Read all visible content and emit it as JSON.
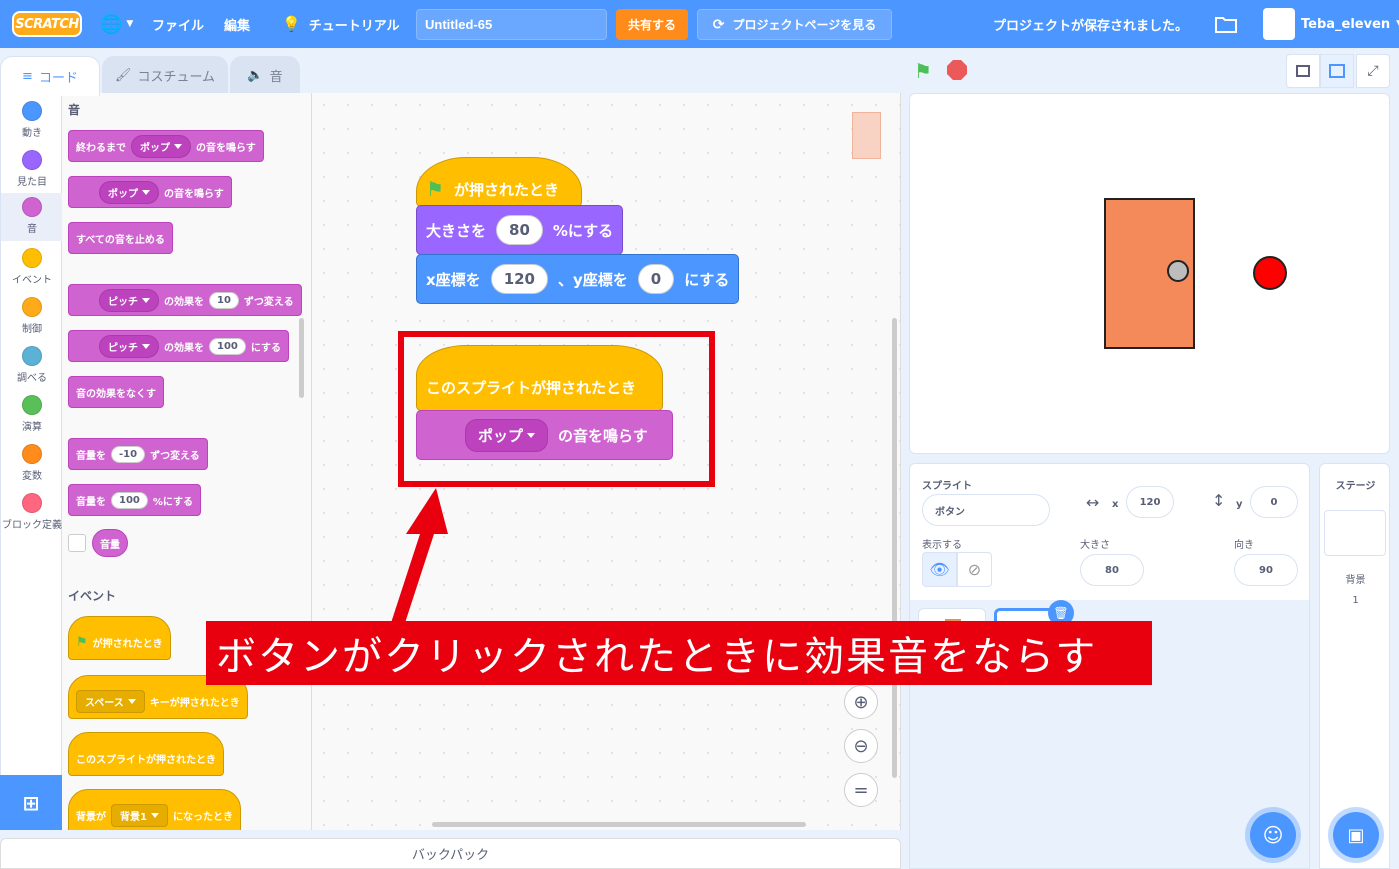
{
  "menubar": {
    "logo": "SCRATCH",
    "file": "ファイル",
    "edit": "編集",
    "tutorial": "チュートリアル",
    "project_title": "Untitled-65",
    "share": "共有する",
    "project_page": "プロジェクトページを見る",
    "save_status": "プロジェクトが保存されました。",
    "username": "Teba_eleven"
  },
  "tabs": {
    "code": "コード",
    "costume": "コスチューム",
    "sound": "音"
  },
  "categories": [
    {
      "label": "動き",
      "color": "#4c97ff"
    },
    {
      "label": "見た目",
      "color": "#9966ff"
    },
    {
      "label": "音",
      "color": "#cf63cf"
    },
    {
      "label": "イベント",
      "color": "#ffbf00"
    },
    {
      "label": "制御",
      "color": "#ffab19"
    },
    {
      "label": "調べる",
      "color": "#5cb1d6"
    },
    {
      "label": "演算",
      "color": "#59c059"
    },
    {
      "label": "変数",
      "color": "#ff8c1a"
    },
    {
      "label": "ブロック定義",
      "color": "#ff6680"
    }
  ],
  "palette": {
    "sound_header": "音",
    "play_until_done_a": "終わるまで",
    "play_until_done_dd": "ポップ",
    "play_until_done_b": "の音を鳴らす",
    "start_sound_dd": "ポップ",
    "start_sound_b": "の音を鳴らす",
    "stop_all": "すべての音を止める",
    "change_effect_dd": "ピッチ",
    "change_effect_a": "の効果を",
    "change_effect_val": "10",
    "change_effect_b": "ずつ変える",
    "set_effect_dd": "ピッチ",
    "set_effect_a": "の効果を",
    "set_effect_val": "100",
    "set_effect_b": "にする",
    "clear_effects": "音の効果をなくす",
    "change_vol_a": "音量を",
    "change_vol_val": "-10",
    "change_vol_b": "ずつ変える",
    "set_vol_a": "音量を",
    "set_vol_val": "100",
    "set_vol_b": "%にする",
    "volume": "音量",
    "event_header": "イベント",
    "flag_clicked": "が押されたとき",
    "key_dd": "スペース",
    "key_b": "キーが押されたとき",
    "sprite_clicked": "このスプライトが押されたとき",
    "backdrop_a": "背景が",
    "backdrop_dd": "背景1",
    "backdrop_b": "になったとき"
  },
  "workspace": {
    "flag_hat": "が押されたとき",
    "size_a": "大きさを",
    "size_val": "80",
    "size_b": "%にする",
    "goto_a": "x座標を",
    "goto_x": "120",
    "goto_mid": "、y座標を",
    "goto_y": "0",
    "goto_b": "にする",
    "sprite_hat": "このスプライトが押されたとき",
    "play_dd": "ポップ",
    "play_b": "の音を鳴らす"
  },
  "backpack": "バックパック",
  "sprite_info": {
    "sprite_label": "スプライト",
    "sprite_name": "ボタン",
    "x_label": "x",
    "x_val": "120",
    "y_label": "y",
    "y_val": "0",
    "show_label": "表示する",
    "size_label": "大きさ",
    "size_val": "80",
    "direction_label": "向き",
    "direction_val": "90"
  },
  "stage_panel": {
    "title": "ステージ",
    "backdrop_label": "背景",
    "backdrop_count": "1"
  },
  "annotation": {
    "text": "ボタンがクリックされたときに効果音をならす"
  },
  "colors": {
    "accent": "#4c97ff",
    "highlight": "#e8000f",
    "door": "#f4895a",
    "ball": "#ff0000"
  }
}
